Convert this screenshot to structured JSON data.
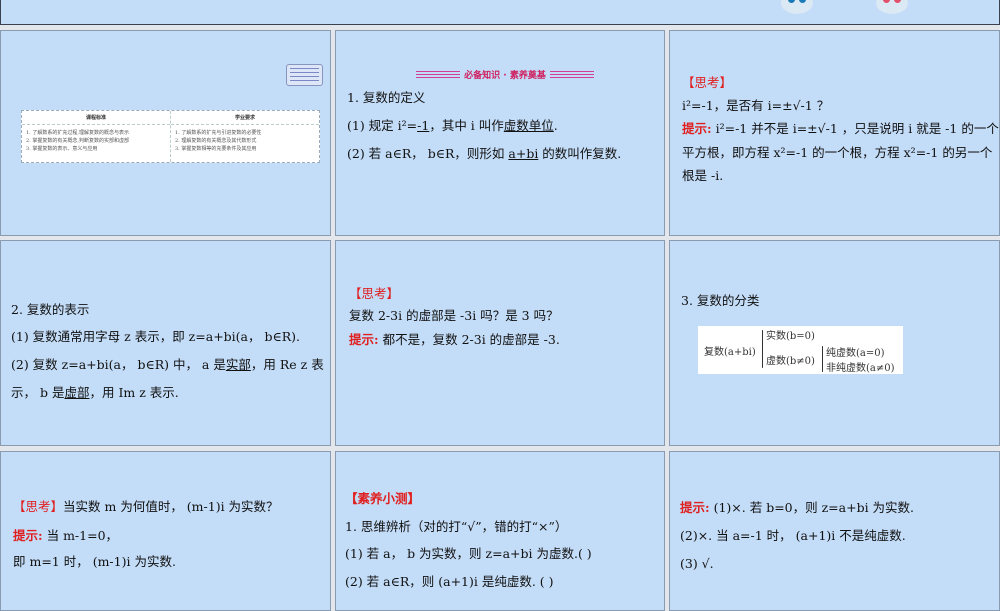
{
  "slides": [
    {
      "table": {
        "headers": [
          "课程标准",
          "学业要求"
        ],
        "col1": [
          "1. 了解数系的扩充过程,理解复数的概念与表示",
          "2. 掌握复数的有关概念,判断复数的实部和虚部",
          "3. 掌握复数的表示、意义与应用"
        ],
        "col2": [
          "1. 了解数系的扩充与引进复数的必要性",
          "2. 理解复数的有关概念及其代数形式",
          "3. 掌握复数相等的充要条件及其应用"
        ]
      }
    },
    {
      "ribbon": "必备知识 · 素养奠基",
      "title": "1. 复数的定义",
      "l1": [
        "(1) 规定 i²=",
        "-1",
        "，其中 i 叫作",
        "虚数单位",
        "."
      ],
      "l2": [
        "(2) 若 a∈R， b∈R，则形如 ",
        "a+bi",
        " 的数叫作复数."
      ]
    },
    {
      "tag": "【思考】",
      "q": "i²=-1，是否有 i=±√-1  ？",
      "hint_label": "提示:",
      "a1": " i²=-1 并不是 i=±√-1  ，只是说明 i 就是 -1 的一个",
      "a2": "平方根，即方程 x²=-1 的一个根，方程 x²=-1 的另一个",
      "a3": "根是 -i."
    },
    {
      "title": "2. 复数的表示",
      "l1": "(1) 复数通常用字母 z 表示，即 z=a+bi(a， b∈R).",
      "l2": [
        "(2) 复数 z=a+bi(a， b∈R) 中， a 是",
        "实部",
        "，用 Re z 表"
      ],
      "l3": [
        "示， b 是",
        "虚部",
        "，用 Im z 表示."
      ]
    },
    {
      "tag": "【思考】",
      "q": "复数 2-3i 的虚部是 -3i 吗？是 3 吗？",
      "hint_label": "提示:",
      "a": " 都不是，复数 2-3i 的虚部是 -3."
    },
    {
      "title": "3. 复数的分类",
      "formula": {
        "root": "复数(a+bi)",
        "real": "实数(b=0)",
        "imag": "虚数(b≠0)",
        "pure": "纯虚数(a=0)",
        "nonpure": "非纯虚数(a≠0)"
      }
    },
    {
      "tag": "【思考】",
      "q": "当实数 m 为何值时， (m-1)i 为实数？",
      "hint_label": "提示:",
      "a1": " 当 m-1=0，",
      "a2": "即 m=1 时， (m-1)i 为实数."
    },
    {
      "tag": "【素养小测】",
      "l1": "1. 思维辨析（对的打“√”，错的打“×”）",
      "l2": "(1) 若 a， b 为实数，则 z=a+bi 为虚数.(     )",
      "l3": "(2) 若 a∈R，则 (a+1)i 是纯虚数.     (     )"
    },
    {
      "hint_label": "提示:",
      "l1": " (1)×. 若 b=0，则 z=a+bi 为实数.",
      "l2": "(2)×. 当 a=-1 时， (a+1)i 不是纯虚数.",
      "l3": "(3) √."
    }
  ]
}
